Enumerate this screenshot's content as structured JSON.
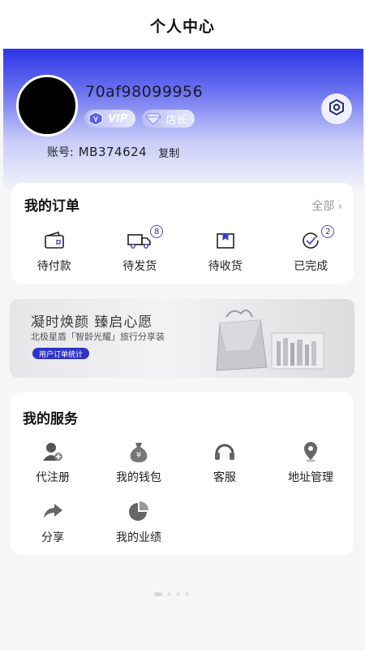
{
  "header": {
    "title": "个人中心"
  },
  "profile": {
    "username": "70af98099956",
    "badges": [
      {
        "label": "VIP",
        "icon": "vip-gem-icon"
      },
      {
        "label": "店长",
        "icon": "diamond-icon"
      }
    ],
    "account_label": "账号:",
    "account_value": "MB374624",
    "copy_label": "复制",
    "settings_icon": "settings-hexagon-icon"
  },
  "orders": {
    "title": "我的订单",
    "all_label": "全部",
    "items": [
      {
        "label": "待付款",
        "icon": "wallet-icon",
        "count": ""
      },
      {
        "label": "待发货",
        "icon": "truck-icon",
        "count": "8"
      },
      {
        "label": "待收货",
        "icon": "box-icon",
        "count": ""
      },
      {
        "label": "已完成",
        "icon": "check-circle-icon",
        "count": "2"
      }
    ]
  },
  "banner": {
    "headline": "凝时焕颜 臻启心愿",
    "subline": "北极星盾「智龄光耀」旅行分享装",
    "button_label": "用户订单统计"
  },
  "services": {
    "title": "我的服务",
    "items": [
      {
        "label": "代注册",
        "icon": "user-add-icon"
      },
      {
        "label": "我的钱包",
        "icon": "money-bag-icon"
      },
      {
        "label": "客服",
        "icon": "headset-icon"
      },
      {
        "label": "地址管理",
        "icon": "location-pin-icon"
      },
      {
        "label": "分享",
        "icon": "share-arrow-icon"
      },
      {
        "label": "我的业绩",
        "icon": "pie-chart-icon"
      }
    ]
  },
  "colors": {
    "accent": "#2d33c7",
    "hero_top": "#2c34e8"
  }
}
